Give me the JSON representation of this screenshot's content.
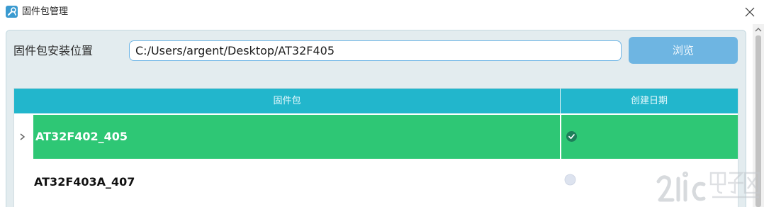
{
  "window": {
    "title": "固件包管理",
    "icon": "wrench-app-icon",
    "close_icon": "close-icon"
  },
  "install": {
    "label": "固件包安装位置",
    "path_value": "C:/Users/argent/Desktop/AT32F405",
    "browse_label": "浏览"
  },
  "table": {
    "columns": [
      "固件包",
      "创建日期"
    ],
    "rows": [
      {
        "name": "AT32F402_405",
        "selected": true,
        "status_icon": "check-circle-icon"
      },
      {
        "name": "AT32F403A_407",
        "selected": false,
        "status_icon": "radio-empty-icon"
      }
    ]
  },
  "colors": {
    "header_bg": "#22b6cc",
    "selected_row_bg": "#2ec775",
    "browse_button_bg": "#6eb5e2",
    "input_border": "#6fb6e6",
    "panel_bg": "#e3ecef"
  }
}
